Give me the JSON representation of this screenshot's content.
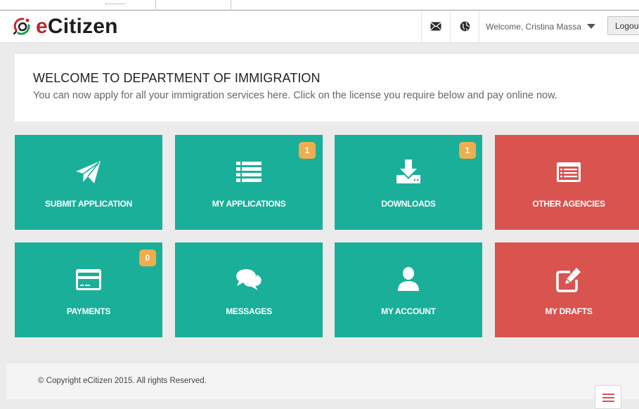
{
  "brand": {
    "name_e": "e",
    "name_rest": "Citizen"
  },
  "nav": {
    "mail_icon": "envelope-icon",
    "globe_icon": "globe-icon",
    "user_greeting": "Welcome, Cristina Massa",
    "logout_label": "Logout"
  },
  "welcome": {
    "title": "WELCOME TO DEPARTMENT OF IMMIGRATION",
    "subtitle": "You can now apply for all your immigration services here. Click on the license you require below and pay online now."
  },
  "tiles": [
    {
      "label": "SUBMIT APPLICATION",
      "icon": "paper-plane-icon",
      "color": "#1aaf99"
    },
    {
      "label": "MY APPLICATIONS",
      "icon": "list-icon",
      "color": "#1aaf99",
      "badge": "1"
    },
    {
      "label": "DOWNLOADS",
      "icon": "download-icon",
      "color": "#1aaf99",
      "badge": "1"
    },
    {
      "label": "OTHER AGENCIES",
      "icon": "list-alt-icon",
      "color": "#d9534f"
    },
    {
      "label": "PAYMENTS",
      "icon": "credit-card-icon",
      "color": "#1aaf99",
      "badge": "0"
    },
    {
      "label": "MESSAGES",
      "icon": "comments-icon",
      "color": "#1aaf99"
    },
    {
      "label": "MY ACCOUNT",
      "icon": "user-icon",
      "color": "#1aaf99"
    },
    {
      "label": "MY DRAFTS",
      "icon": "edit-icon",
      "color": "#d9534f"
    }
  ],
  "colors": {
    "teal": "#1aaf99",
    "red": "#d9534f",
    "badge": "#f0ad4e"
  },
  "footer": {
    "copyright": "© Copyright eCitizen 2015. All rights Reserved."
  }
}
